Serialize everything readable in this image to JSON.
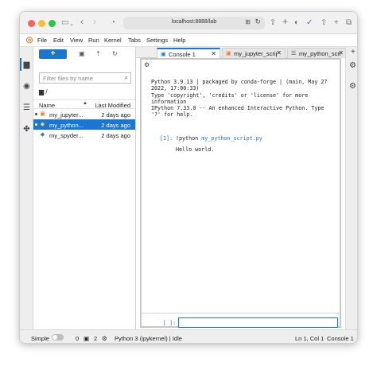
{
  "browser": {
    "url": "localhost:8888/lab"
  },
  "menubar": {
    "items": [
      "File",
      "Edit",
      "View",
      "Run",
      "Kernel",
      "Tabs",
      "Settings",
      "Help"
    ]
  },
  "filebrowser": {
    "new_label": "+",
    "filter_placeholder": "Filter files by name",
    "path": "/",
    "columns": {
      "name": "Name",
      "modified": "Last Modified"
    },
    "files": [
      {
        "name": "my_jupyter...",
        "modified": "2 days ago",
        "icon": "notebook-icon",
        "running": true,
        "selected": false
      },
      {
        "name": "my_python...",
        "modified": "2 days ago",
        "icon": "python-icon",
        "running": true,
        "selected": true
      },
      {
        "name": "my_spyder...",
        "modified": "2 days ago",
        "icon": "python-icon",
        "running": false,
        "selected": false
      }
    ]
  },
  "tabs": [
    {
      "label": "Console 1",
      "icon": "console-icon",
      "active": true
    },
    {
      "label": "my_jupyter_script",
      "icon": "notebook-icon",
      "active": false
    },
    {
      "label": "my_python_script",
      "icon": "text-file-icon",
      "active": false
    }
  ],
  "console": {
    "banner": "Python 3.9.13 | packaged by conda-forge | (main, May 27\n2022, 17:00:33)\nType 'copyright', 'credits' or 'license' for more\ninformation\nIPython 7.33.0 -- An enhanced Interactive Python. Type\n'?' for help.",
    "cell_prompt": "[1]:",
    "cell_command": "!python ",
    "cell_file": "my_python_script.py",
    "cell_output": "Hello world.",
    "input_prompt": "[ ]:"
  },
  "statusbar": {
    "mode": "Simple",
    "terminals": "0",
    "kernels": "2",
    "kernel_status": "Python 3 (ipykernel) | Idle",
    "cursor": "Ln 1, Col 1",
    "console_name": "Console 1"
  },
  "colors": {
    "accent": "#1976d2",
    "jupyter_orange": "#f37726"
  }
}
